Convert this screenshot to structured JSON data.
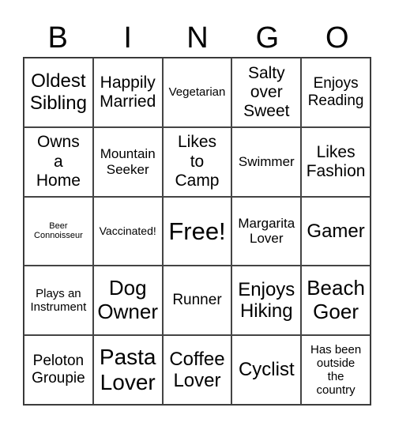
{
  "header": [
    "B",
    "I",
    "N",
    "G",
    "O"
  ],
  "cells": [
    "Oldest\nSibling",
    "Happily\nMarried",
    "Vegetarian",
    "Salty\nover\nSweet",
    "Enjoys\nReading",
    "Owns\na\nHome",
    "Mountain\nSeeker",
    "Likes\nto\nCamp",
    "Swimmer",
    "Likes\nFashion",
    "Beer\nConnoisseur",
    "Vaccinated!",
    "Free!",
    "Margarita\nLover",
    "Gamer",
    "Plays an\nInstrument",
    "Dog\nOwner",
    "Runner",
    "Enjoys\nHiking",
    "Beach\nGoer",
    "Peloton\nGroupie",
    "Pasta\nLover",
    "Coffee\nLover",
    "Cyclist",
    "Has been\noutside\nthe\ncountry"
  ]
}
